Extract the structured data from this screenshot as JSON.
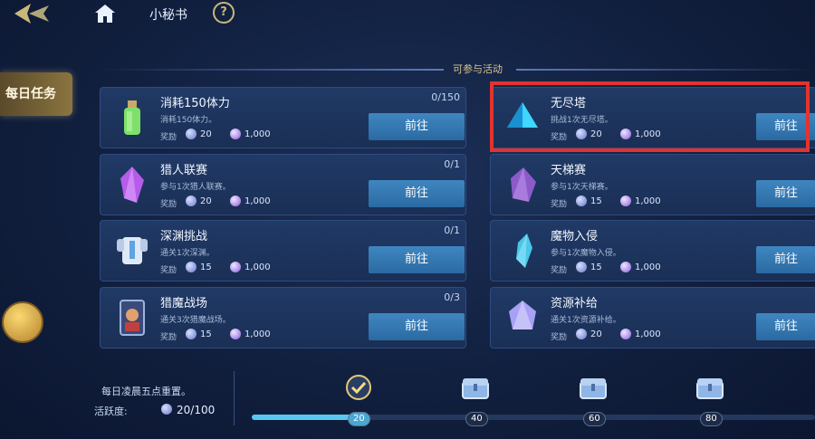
{
  "header": {
    "title": "小秘书",
    "help_label": "?"
  },
  "side": {
    "daily_tab": "每日任务"
  },
  "section": {
    "label": "可参与活动"
  },
  "common": {
    "go_label": "前往",
    "reward_label": "奖励"
  },
  "tasks": [
    {
      "name": "消耗150体力",
      "desc": "消耗150体力。",
      "progress": "0/150",
      "reward_a": "20",
      "reward_b": "1,000"
    },
    {
      "name": "无尽塔",
      "desc": "挑战1次无尽塔。",
      "progress": "",
      "reward_a": "20",
      "reward_b": "1,000"
    },
    {
      "name": "猎人联赛",
      "desc": "参与1次猎人联赛。",
      "progress": "0/1",
      "reward_a": "20",
      "reward_b": "1,000"
    },
    {
      "name": "天梯赛",
      "desc": "参与1次天梯赛。",
      "progress": "",
      "reward_a": "15",
      "reward_b": "1,000"
    },
    {
      "name": "深渊挑战",
      "desc": "通关1次深渊。",
      "progress": "0/1",
      "reward_a": "15",
      "reward_b": "1,000"
    },
    {
      "name": "魔物入侵",
      "desc": "参与1次魔物入侵。",
      "progress": "",
      "reward_a": "15",
      "reward_b": "1,000"
    },
    {
      "name": "猎魔战场",
      "desc": "通关3次猎魔战场。",
      "progress": "0/3",
      "reward_a": "15",
      "reward_b": "1,000"
    },
    {
      "name": "资源补给",
      "desc": "通关1次资源补给。",
      "progress": "",
      "reward_a": "20",
      "reward_b": "1,000"
    }
  ],
  "bottom": {
    "reset_text": "每日凌晨五点重置。",
    "activity_label": "活跃度:",
    "activity_value": "20/100",
    "activity_fraction": 0.2,
    "milestones": [
      "20",
      "40",
      "60",
      "80"
    ]
  },
  "colors": {
    "highlight": "#e1332f",
    "button": "#2f74b0",
    "accent_gold": "#c9b87a"
  }
}
